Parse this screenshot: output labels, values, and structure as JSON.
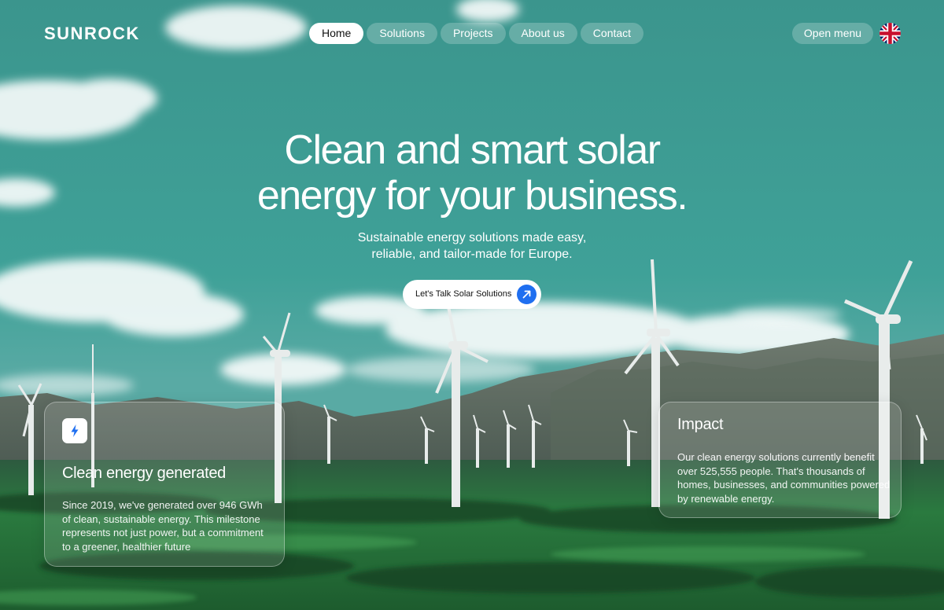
{
  "header": {
    "logo": "SUNROCK",
    "nav": [
      "Home",
      "Solutions",
      "Projects",
      "About us",
      "Contact"
    ],
    "active_nav": "Home",
    "open_menu": "Open menu",
    "language_flag": "uk-flag-icon"
  },
  "hero": {
    "title_line1": "Clean and smart solar",
    "title_line2": "energy for your business.",
    "subtitle_line1": "Sustainable energy solutions made easy,",
    "subtitle_line2": "reliable, and tailor-made for Europe.",
    "cta_label": "Let's Talk Solar Solutions",
    "cta_icon": "arrow-up-right-icon"
  },
  "cards": {
    "energy": {
      "icon": "lightning-bolt-icon",
      "title": "Clean energy generated",
      "text": "Since 2019, we've generated over 946 GWh of clean, sustainable energy. This milestone represents not just power, but a commitment to a greener, healthier future"
    },
    "impact": {
      "title": "Impact",
      "text": "Our clean energy solutions currently benefit over 525,555 people. That's thousands of homes, businesses, and communities powered by renewable energy."
    }
  },
  "colors": {
    "accent": "#1f6ff0",
    "sky": "#3d9a92",
    "field": "#2c7a3c"
  }
}
